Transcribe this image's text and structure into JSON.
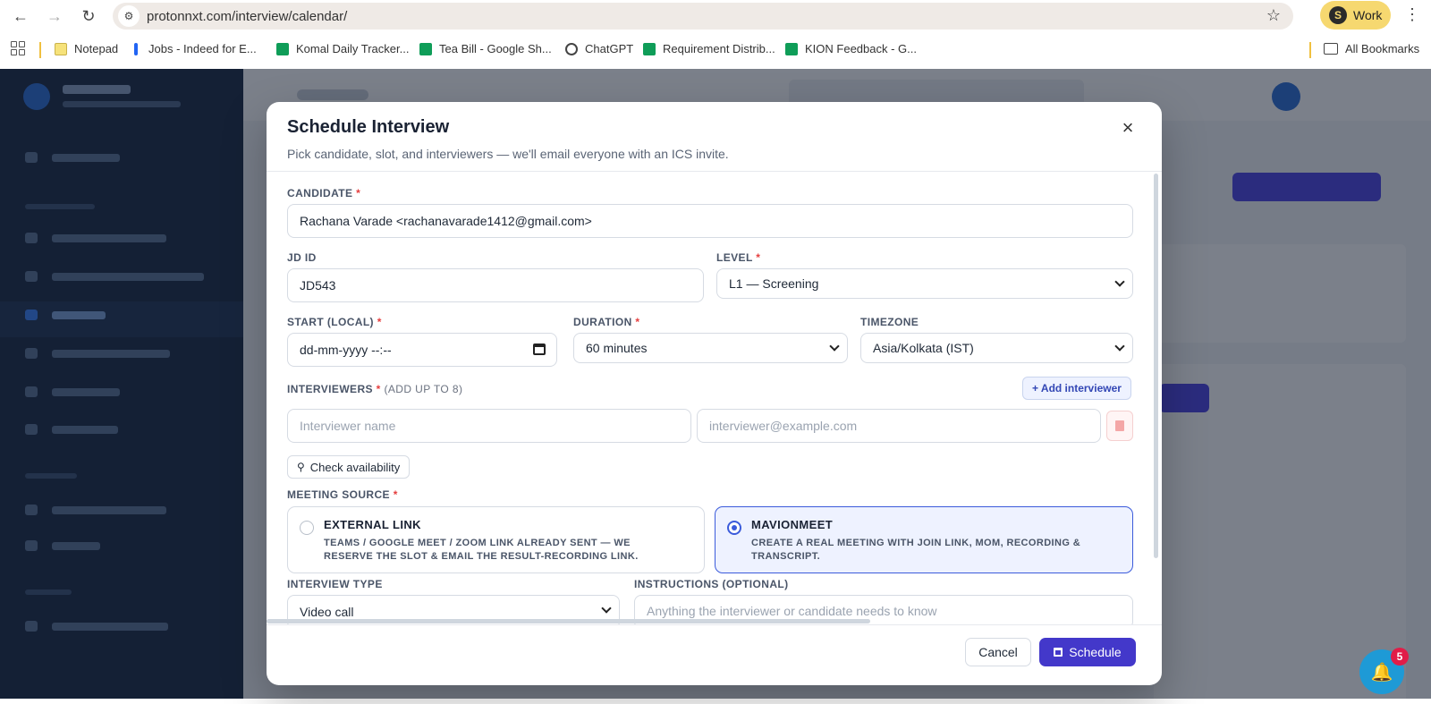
{
  "browser": {
    "url": "protonnxt.com/interview/calendar/",
    "profile_label": "Work",
    "profile_initial": "S"
  },
  "bookmarks": {
    "items": [
      {
        "label": "Notepad",
        "color": "#f6e27a"
      },
      {
        "label": "Jobs - Indeed for E...",
        "color": "#2164f3"
      },
      {
        "label": "Komal Daily Tracker...",
        "color": "#0f9d58"
      },
      {
        "label": "Tea Bill - Google Sh...",
        "color": "#0f9d58"
      },
      {
        "label": "ChatGPT",
        "color": "#444444"
      },
      {
        "label": "Requirement Distrib...",
        "color": "#0f9d58"
      },
      {
        "label": "KION Feedback - G...",
        "color": "#0f9d58"
      }
    ],
    "all_bookmarks": "All Bookmarks"
  },
  "modal": {
    "title": "Schedule Interview",
    "subtitle": "Pick candidate, slot, and interviewers — we'll email everyone with an ICS invite.",
    "close_icon": "close-icon",
    "candidate": {
      "label": "CANDIDATE",
      "required": "*",
      "value": "Rachana Varade <rachanavarade1412@gmail.com>"
    },
    "jd_id": {
      "label": "JD ID",
      "value": "JD543"
    },
    "level": {
      "label": "LEVEL",
      "required": "*",
      "value": "L1 — Screening"
    },
    "start": {
      "label": "START (LOCAL)",
      "required": "*",
      "value": "dd-mm-yyyy --:--"
    },
    "duration": {
      "label": "DURATION",
      "required": "*",
      "value": "60 minutes"
    },
    "timezone": {
      "label": "TIMEZONE",
      "value": "Asia/Kolkata (IST)"
    },
    "interviewers": {
      "label": "INTERVIEWERS",
      "required": "*",
      "hint": "(ADD UP TO 8)",
      "add_button": "+ Add interviewer",
      "name_placeholder": "Interviewer name",
      "email_placeholder": "interviewer@example.com"
    },
    "check_availability": "Check availability",
    "meeting_source": {
      "label": "MEETING SOURCE",
      "required": "*",
      "options": [
        {
          "title": "EXTERNAL LINK",
          "desc": "TEAMS / GOOGLE MEET / ZOOM LINK ALREADY SENT — WE RESERVE THE SLOT & EMAIL THE RESULT-RECORDING LINK.",
          "selected": false
        },
        {
          "title": "MAVIONMEET",
          "desc": "CREATE A REAL MEETING WITH JOIN LINK, MOM, RECORDING & TRANSCRIPT.",
          "selected": true
        }
      ]
    },
    "interview_type": {
      "label": "INTERVIEW TYPE",
      "value": "Video call"
    },
    "instructions": {
      "label": "INSTRUCTIONS (OPTIONAL)",
      "placeholder": "Anything the interviewer or candidate needs to know"
    },
    "cancel": "Cancel",
    "schedule": "Schedule"
  },
  "notifications": {
    "count": "5"
  },
  "colors": {
    "primary": "#4338ca",
    "accent": "#3b5bdb",
    "required": "#e53e3e"
  }
}
